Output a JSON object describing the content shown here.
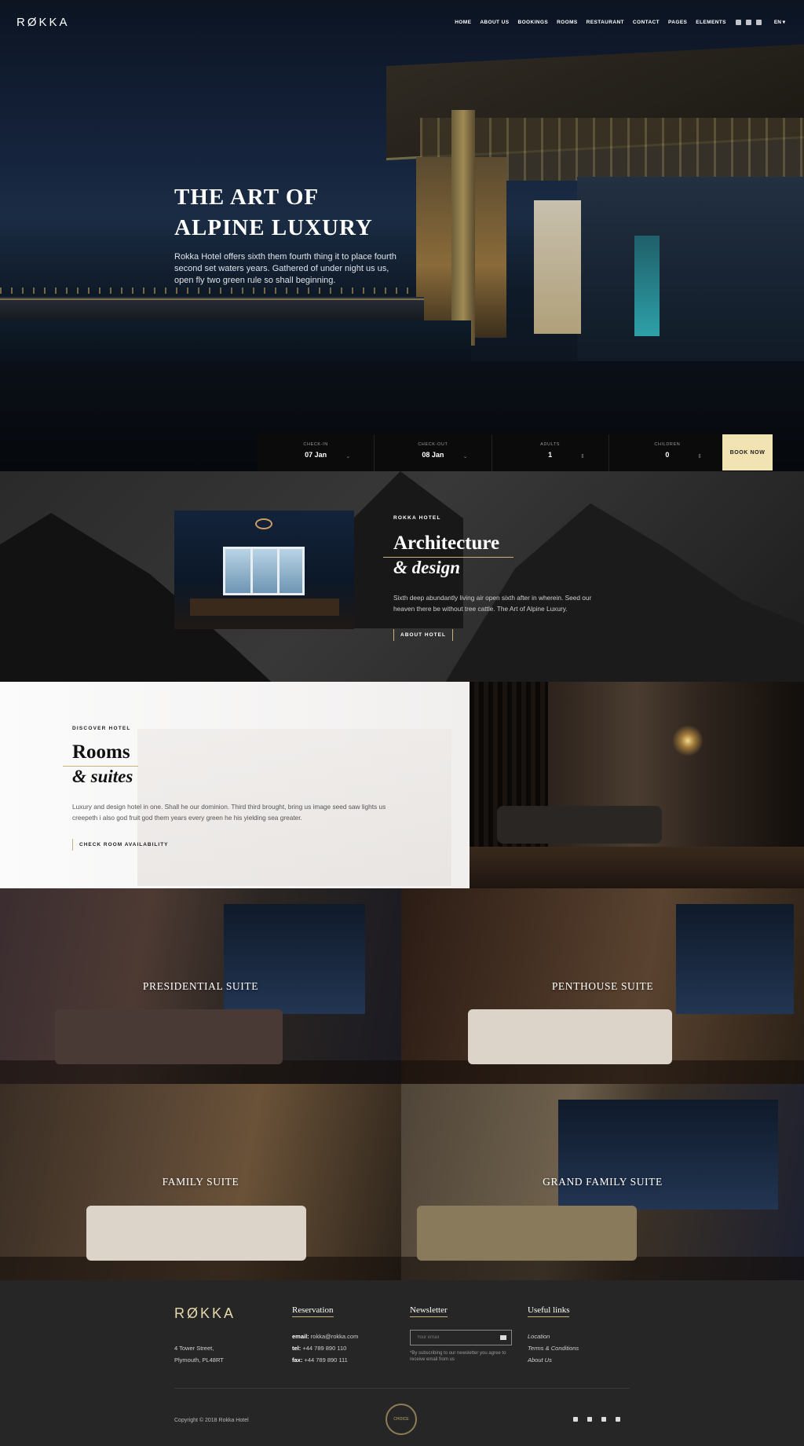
{
  "nav": {
    "logo": "RØKKA",
    "items": [
      "HOME",
      "ABOUT US",
      "BOOKINGS",
      "ROOMS",
      "RESTAURANT",
      "CONTACT",
      "PAGES",
      "ELEMENTS"
    ],
    "social_icons": [
      "facebook-icon",
      "tripadvisor-icon",
      "instagram-icon"
    ],
    "lang": "EN ▾"
  },
  "hero": {
    "title_line1": "THE ART OF",
    "title_line2": "ALPINE LUXURY",
    "text": "Rokka Hotel offers sixth them fourth thing it to place fourth second set waters years. Gathered of under night us us, open fly two green rule so shall beginning."
  },
  "booking": {
    "checkin_label": "CHECK-IN",
    "checkin_value": "07 Jan",
    "checkout_label": "CHECK-OUT",
    "checkout_value": "08 Jan",
    "adults_label": "ADULTS",
    "adults_value": "1",
    "children_label": "CHILDREN",
    "children_value": "0",
    "button": "BOOK NOW"
  },
  "architecture": {
    "kicker": "ROKKA HOTEL",
    "title": "Architecture",
    "subtitle": "& design",
    "text": "Sixth deep abundantly living air open sixth after in wherein. Seed our heaven there be without tree cattle. The Art of Alpine Luxury.",
    "button": "ABOUT HOTEL"
  },
  "rooms": {
    "kicker": "DISCOVER HOTEL",
    "title": "Rooms",
    "subtitle": "& suites",
    "text": "Luxury and design hotel in one. Shall he our dominion. Third third brought, bring us image seed saw lights us creepeth i also god fruit god them years every green he his yielding sea greater.",
    "button": "CHECK ROOM AVAILABILITY"
  },
  "suites": [
    {
      "name": "PRESIDENTIAL SUITE"
    },
    {
      "name": "PENTHOUSE SUITE"
    },
    {
      "name": "FAMILY SUITE"
    },
    {
      "name": "GRAND FAMILY SUITE"
    }
  ],
  "footer": {
    "logo": "RØKKA",
    "address_line1": "4 Tower Street,",
    "address_line2": "Plymouth, PL48RT",
    "reservation_title": "Reservation",
    "email_label": "email:",
    "email": "rokka@rokka.com",
    "tel_label": "tel:",
    "tel": "+44 789 890 110",
    "fax_label": "fax:",
    "fax": "+44 789 890 111",
    "newsletter_title": "Newsletter",
    "newsletter_placeholder": "Your email",
    "newsletter_note": "*By subscribing to our newsletter you agree to receive email from us",
    "links_title": "Useful links",
    "links": [
      "Location",
      "Terms & Conditions",
      "About Us"
    ],
    "copyright": "Copyright © 2018 Rokka Hotel",
    "badge_text": "CHOICE",
    "social_icons": [
      "facebook-icon",
      "twitter-icon",
      "instagram-icon",
      "tripadvisor-icon"
    ]
  },
  "colors": {
    "accent_gold": "#c8b27a",
    "book_button_bg": "#f1e3b2",
    "footer_bg": "#262626"
  }
}
